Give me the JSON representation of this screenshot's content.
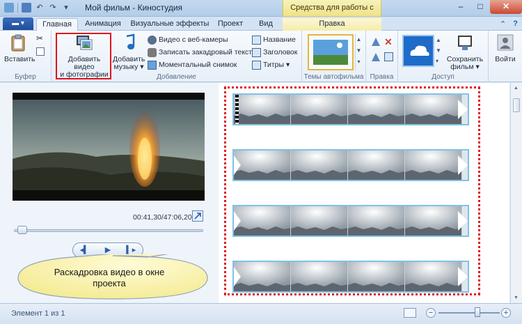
{
  "window": {
    "title": "Мой фильм - Киностудия",
    "contextual_group": "Средства для работы с видео",
    "minimize": "–",
    "maximize": "□",
    "close": "✕"
  },
  "menu_button": "▬ ▾",
  "tabs": [
    {
      "label": "Главная",
      "active": true
    },
    {
      "label": "Анимация"
    },
    {
      "label": "Визуальные эффекты"
    },
    {
      "label": "Проект"
    },
    {
      "label": "Вид"
    },
    {
      "label": "Правка"
    }
  ],
  "ribbon": {
    "clipboard": {
      "label": "Буфер",
      "paste": "Вставить"
    },
    "add": {
      "label": "Добавление",
      "add_video_line1": "Добавить видео",
      "add_video_line2": "и фотографии",
      "add_music_line1": "Добавить",
      "add_music_line2": "музыку",
      "webcam": "Видео с веб-камеры",
      "narration": "Записать закадровый текст",
      "snapshot": "Моментальный снимок",
      "title": "Название",
      "caption": "Заголовок",
      "credits": "Титры"
    },
    "themes": {
      "label": "Темы автофильма"
    },
    "editing": {
      "label": "Правка"
    },
    "share": {
      "label": "Доступ",
      "save_line1": "Сохранить",
      "save_line2": "фильм"
    },
    "signin": {
      "label": "Войти"
    }
  },
  "preview": {
    "timecode": "00:41,30/47:06,20",
    "position_fraction": 0.02
  },
  "callout": {
    "line1": "Раскадровка видео в окне",
    "line2": "проекта"
  },
  "status": {
    "element_count": "Элемент 1 из 1",
    "zoom_minus": "−",
    "zoom_plus": "+",
    "zoom_fraction": 0.62
  },
  "colors": {
    "highlight": "#e0141a",
    "strip_border": "#7fc3e6",
    "accent": "#1f4c9a"
  }
}
